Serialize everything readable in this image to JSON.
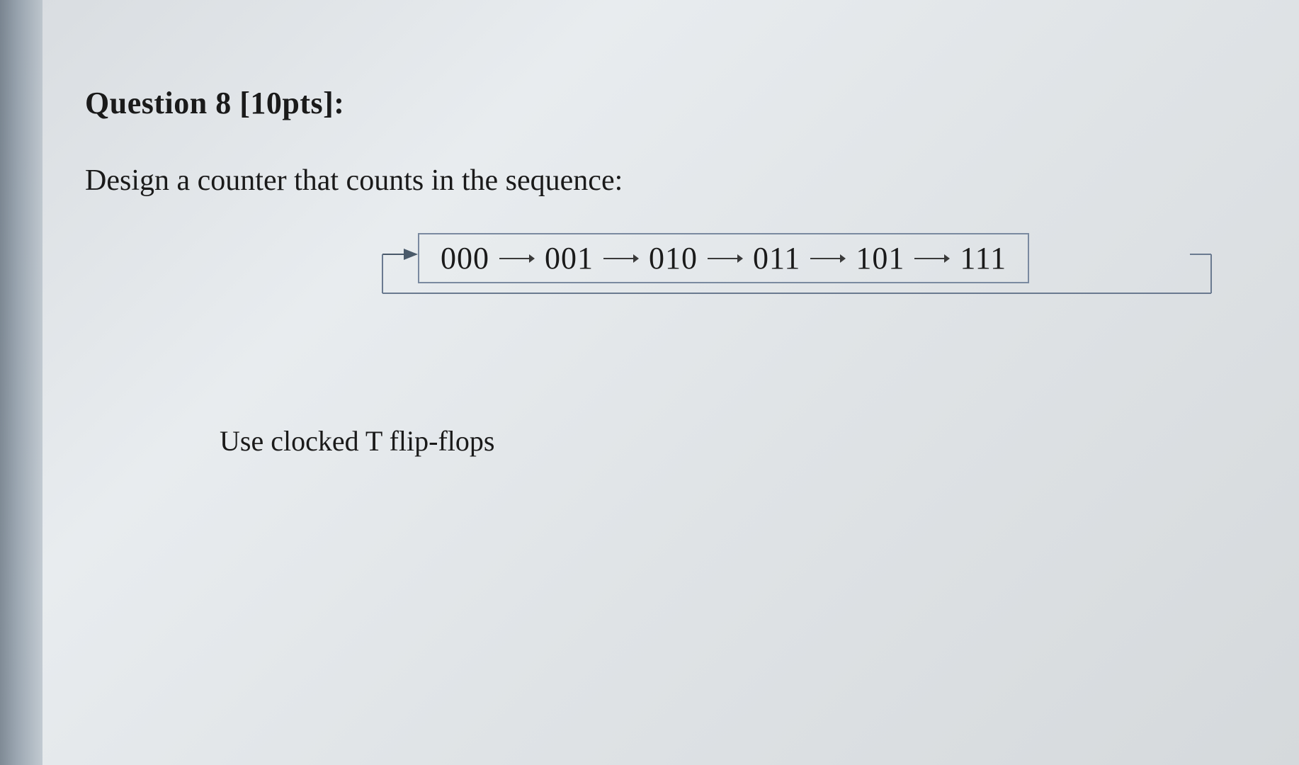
{
  "question": {
    "title": "Question 8 [10pts]:",
    "prompt": "Design a counter that counts in the sequence:",
    "instruction": "Use clocked T flip-flops"
  },
  "sequence": {
    "states": [
      "000",
      "001",
      "010",
      "011",
      "101",
      "111"
    ]
  }
}
